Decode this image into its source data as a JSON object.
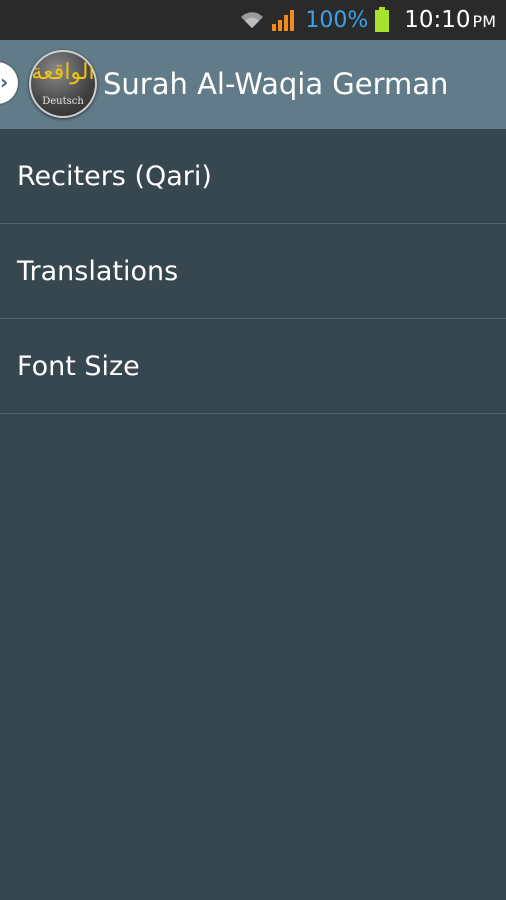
{
  "status_bar": {
    "battery_percent": "100%",
    "time": "10:10",
    "ampm": "PM",
    "icons": [
      "wifi-icon",
      "signal-icon",
      "battery-icon"
    ],
    "colors": {
      "battery_text": "#3ba4e6",
      "signal": "#f28b1c",
      "battery": "#a6e22e"
    }
  },
  "action_bar": {
    "title": "Surah Al-Waqia German",
    "logo": {
      "arabic": "الواقعة",
      "sub": "Deutsch"
    },
    "background": "#627b89"
  },
  "menu": {
    "items": [
      {
        "label": "Reciters (Qari)"
      },
      {
        "label": "Translations"
      },
      {
        "label": "Font Size"
      }
    ]
  }
}
